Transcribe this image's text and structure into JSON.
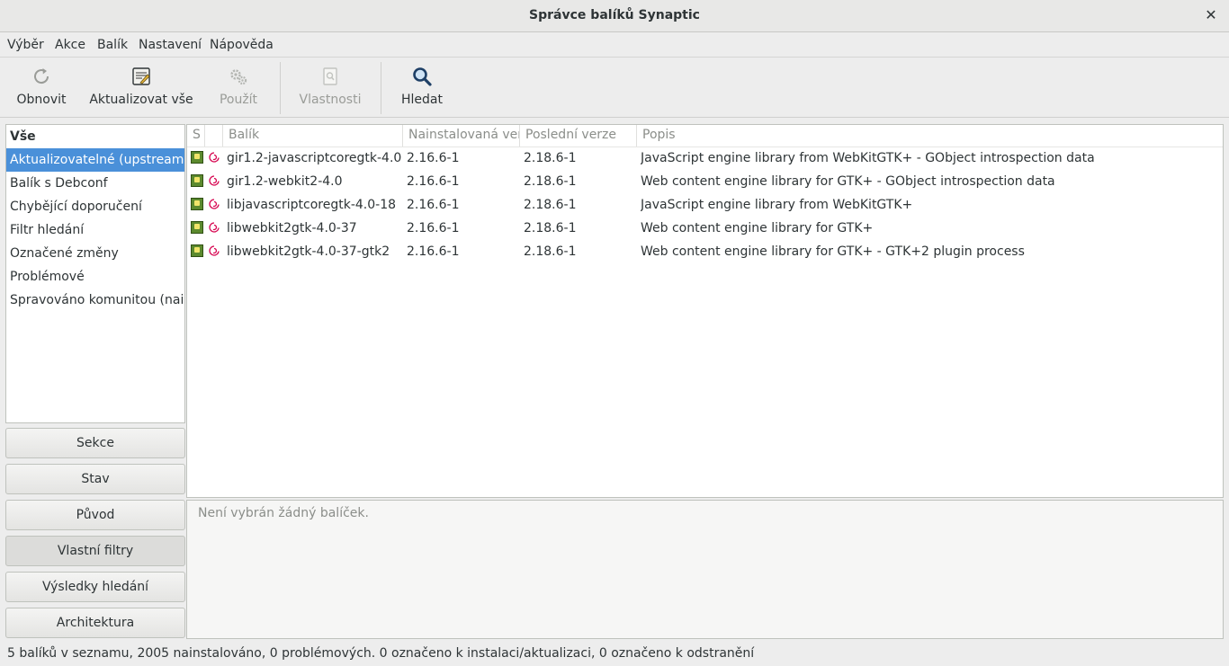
{
  "window": {
    "title": "Správce balíků Synaptic",
    "close_glyph": "✕"
  },
  "menubar": [
    "Výběr",
    "Akce",
    "Balík",
    "Nastavení",
    "Nápověda"
  ],
  "toolbar": {
    "reload": {
      "label": "Obnovit",
      "icon": "reload-icon",
      "enabled": true
    },
    "mark_all_upgrades": {
      "label": "Aktualizovat vše",
      "icon": "upgrade-all-icon",
      "enabled": true
    },
    "apply": {
      "label": "Použít",
      "icon": "apply-gears-icon",
      "enabled": false
    },
    "properties": {
      "label": "Vlastnosti",
      "icon": "properties-icon",
      "enabled": false
    },
    "search": {
      "label": "Hledat",
      "icon": "search-icon",
      "enabled": true
    }
  },
  "filters": {
    "items": [
      {
        "label": "Vše",
        "style": "header"
      },
      {
        "label": "Aktualizovatelné (upstream)",
        "style": "selected"
      },
      {
        "label": "Balík s Debconf",
        "style": "normal"
      },
      {
        "label": "Chybějící doporučení",
        "style": "normal"
      },
      {
        "label": "Filtr hledání",
        "style": "normal"
      },
      {
        "label": "Označené změny",
        "style": "normal"
      },
      {
        "label": "Problémové",
        "style": "normal"
      },
      {
        "label": "Spravováno komunitou (nainstalováno)",
        "style": "normal"
      }
    ]
  },
  "side_buttons": {
    "sections": "Sekce",
    "status": "Stav",
    "origin": "Původ",
    "custom_filters": "Vlastní filtry",
    "search_results": "Výsledky hledání",
    "architecture": "Architektura"
  },
  "columns": {
    "status": "S",
    "package": "Balík",
    "installed_version": "Nainstalovaná verze",
    "latest_version": "Poslední verze",
    "description": "Popis"
  },
  "packages": [
    {
      "name": "gir1.2-javascriptcoregtk-4.0",
      "installed": "2.16.6-1",
      "latest": "2.18.6-1",
      "description": "JavaScript engine library from WebKitGTK+ - GObject introspection data"
    },
    {
      "name": "gir1.2-webkit2-4.0",
      "installed": "2.16.6-1",
      "latest": "2.18.6-1",
      "description": "Web content engine library for GTK+ - GObject introspection data"
    },
    {
      "name": "libjavascriptcoregtk-4.0-18",
      "installed": "2.16.6-1",
      "latest": "2.18.6-1",
      "description": "JavaScript engine library from WebKitGTK+"
    },
    {
      "name": "libwebkit2gtk-4.0-37",
      "installed": "2.16.6-1",
      "latest": "2.18.6-1",
      "description": "Web content engine library for GTK+"
    },
    {
      "name": "libwebkit2gtk-4.0-37-gtk2",
      "installed": "2.16.6-1",
      "latest": "2.18.6-1",
      "description": "Web content engine library for GTK+ - GTK+2 plugin process"
    }
  ],
  "details": {
    "empty_text": "Není vybrán žádný balíček."
  },
  "statusbar": {
    "text": "5 balíků v seznamu, 2005 nainstalováno, 0 problémových. 0 označeno k instalaci/aktualizaci, 0 označeno k odstranění"
  },
  "colors": {
    "accent": "#4a90d9",
    "debian_red": "#d70751",
    "installed_green": "#5c8a2e"
  }
}
